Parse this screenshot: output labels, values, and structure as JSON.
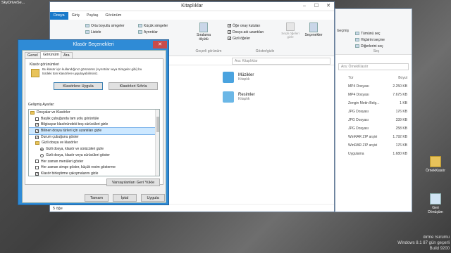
{
  "desktop": {
    "top_label": "SkyDriveSe...",
    "icons": [
      {
        "label": "ÖrnekKlasör",
        "icon": "folder-icon"
      },
      {
        "label": "Geri Dönüşüm",
        "icon": "recycle-bin-icon"
      }
    ],
    "build_text": [
      "dirme Sürümü",
      "Windows 8.1 87 gün geçerli",
      "Build 9200"
    ]
  },
  "explorer": {
    "title": "Kitaplıklar",
    "tabs": [
      "Dosya",
      "Giriş",
      "Paylaş",
      "Görünüm"
    ],
    "active_tab": "Dosya",
    "ribbon": {
      "layout_items": [
        "Orta boyutlu simgeler",
        "Küçük simgeler",
        "Listele",
        "Ayrıntılar"
      ],
      "sort_label": "Sıralama ölçütü",
      "current_view_label": "Geçerli görünüm",
      "show_hide": {
        "item_checkboxes": "Öğe onay kutuları",
        "file_extensions": "Dosya adı uzantıları",
        "hidden_items": "Gizli öğeler",
        "hide_selected": "Seçili öğeleri gizle",
        "group_label": "Göster/gizle"
      },
      "options_label": "Seçenekler"
    },
    "search_placeholder": "Ara: Kitaplıklar",
    "libraries": [
      {
        "name": "Müzikler",
        "sub": "Kitaplık"
      },
      {
        "name": "Resimler",
        "sub": "Kitaplık"
      }
    ],
    "status": "5 öğe"
  },
  "bg_window": {
    "select": [
      "Tümünü seç",
      "Hiçbirini seçme",
      "Diğerlerini seç"
    ],
    "history_label": "Geçmiş",
    "group_label": "Seç",
    "search_placeholder": "Ara: ÖrnekKlasör",
    "col_size": "Boyut",
    "col_type": "Tür",
    "rows": [
      {
        "type": "MP4 Dosyası",
        "size": "2.250 KB"
      },
      {
        "type": "MP4 Dosyası",
        "size": "7.675 KB"
      },
      {
        "type": "Zengin Metin Belg...",
        "size": "1 KB"
      },
      {
        "type": "JPG Dosyası",
        "size": "176 KB"
      },
      {
        "type": "JPG Dosyası",
        "size": "339 KB"
      },
      {
        "type": "JPG Dosyası",
        "size": "258 KB"
      },
      {
        "type": "WinRAR ZIP arşivi",
        "size": "1.792 KB"
      },
      {
        "type": "WinRAR ZIP arşivi",
        "size": "176 KB"
      },
      {
        "type": "Uygulama",
        "size": "1.680 KB"
      }
    ]
  },
  "dialog": {
    "title": "Klasör Seçenekleri",
    "tabs": [
      "Genel",
      "Görünüm",
      "Ara"
    ],
    "active_tab": "Görünüm",
    "folder_views_label": "Klasör görünümleri",
    "folder_views_desc": "Bu klasör için kullandığınız görünümü (Ayrıntılar veya Simgeler gibi) bu türdeki tüm klasörlere uygulayabilirsiniz.",
    "apply_button": "Klasörlere Uygula",
    "reset_button": "Klasörleri Sıfırla",
    "advanced_label": "Gelişmiş Ayarlar:",
    "advanced": [
      {
        "kind": "folder",
        "label": "Dosyalar ve Klasörler",
        "indent": 0
      },
      {
        "kind": "check",
        "checked": false,
        "label": "Başlık çubuğunda tam yolu görüntüle",
        "indent": 1
      },
      {
        "kind": "check",
        "checked": true,
        "label": "Bilgisayar klasöründeki boş sürücüleri gizle",
        "indent": 1
      },
      {
        "kind": "check",
        "checked": true,
        "label": "Bilinen dosya türleri için uzantıları gizle",
        "indent": 1,
        "selected": true
      },
      {
        "kind": "check",
        "checked": true,
        "label": "Durum çubuğunu göster",
        "indent": 1
      },
      {
        "kind": "folder",
        "label": "Gizli dosya ve klasörler",
        "indent": 1
      },
      {
        "kind": "radio",
        "checked": true,
        "label": "Gizli dosya, klasör ve sürücüleri gizle",
        "indent": 2
      },
      {
        "kind": "radio",
        "checked": false,
        "label": "Gizli dosya, klasör veya sürücüleri göster",
        "indent": 2
      },
      {
        "kind": "check",
        "checked": false,
        "label": "Her zaman menüleri göster",
        "indent": 1
      },
      {
        "kind": "check",
        "checked": false,
        "label": "Her zaman simge göster, küçük resim gösterme",
        "indent": 1
      },
      {
        "kind": "check",
        "checked": true,
        "label": "Klasör birleştirme çakışmalarını gizle",
        "indent": 1
      }
    ],
    "restore_defaults": "Varsayılanları Geri Yükle",
    "ok": "Tamam",
    "cancel": "İptal",
    "apply": "Uygula"
  }
}
